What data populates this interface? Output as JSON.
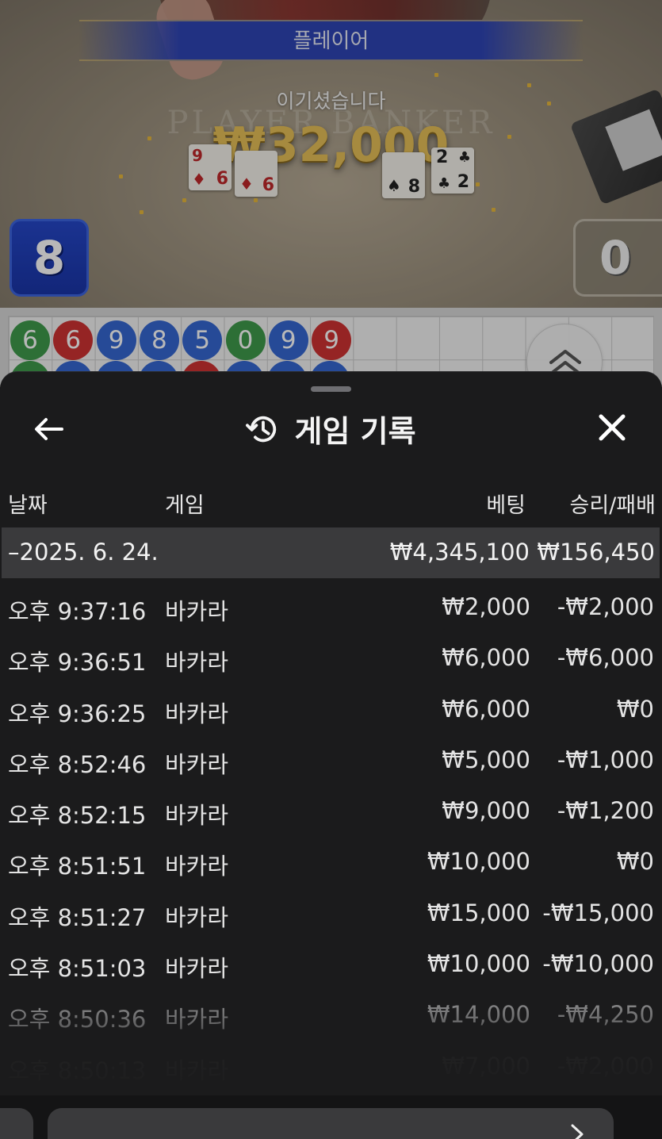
{
  "video": {
    "banner_label": "플레이어",
    "win_message": "이기셨습니다",
    "win_amount": "₩32,000",
    "table_text": "PLAYER    BANKER",
    "player_score": "8",
    "banker_score": "0",
    "player_cards": [
      {
        "rank": "9",
        "suit": "♦",
        "rank2": "6",
        "color": "red"
      },
      {
        "rank": "",
        "suit": "♦",
        "rank2": "6",
        "color": "red"
      }
    ],
    "banker_cards": [
      {
        "rank": "",
        "suit": "♠",
        "rank2": "8",
        "color": "black"
      },
      {
        "rank": "2",
        "suit": "♣",
        "rank2": "2",
        "color": "black"
      }
    ]
  },
  "roadmap": {
    "beads": [
      {
        "value": "6",
        "color": "green"
      },
      {
        "value": "6",
        "color": "red"
      },
      {
        "value": "9",
        "color": "blue"
      },
      {
        "value": "8",
        "color": "blue"
      },
      {
        "value": "5",
        "color": "blue"
      },
      {
        "value": "0",
        "color": "green"
      },
      {
        "value": "9",
        "color": "blue"
      },
      {
        "value": "9",
        "color": "red"
      }
    ]
  },
  "sheet": {
    "title": "게임 기록",
    "columns": {
      "date": "날짜",
      "game": "게임",
      "bet": "베팅",
      "result": "승리/패배"
    },
    "date_group": {
      "date": "–2025. 6. 24.",
      "total_bet": "₩4,345,100",
      "total_result": "₩156,450"
    },
    "rows": [
      {
        "time": "오후 9:37:16",
        "game": "바카라",
        "bet": "₩2,000",
        "result": "-₩2,000"
      },
      {
        "time": "오후 9:36:51",
        "game": "바카라",
        "bet": "₩6,000",
        "result": "-₩6,000"
      },
      {
        "time": "오후 9:36:25",
        "game": "바카라",
        "bet": "₩6,000",
        "result": "₩0"
      },
      {
        "time": "오후 8:52:46",
        "game": "바카라",
        "bet": "₩5,000",
        "result": "-₩1,000"
      },
      {
        "time": "오후 8:52:15",
        "game": "바카라",
        "bet": "₩9,000",
        "result": "-₩1,200"
      },
      {
        "time": "오후 8:51:51",
        "game": "바카라",
        "bet": "₩10,000",
        "result": "₩0"
      },
      {
        "time": "오후 8:51:27",
        "game": "바카라",
        "bet": "₩15,000",
        "result": "-₩15,000"
      },
      {
        "time": "오후 8:51:03",
        "game": "바카라",
        "bet": "₩10,000",
        "result": "-₩10,000"
      },
      {
        "time": "오후 8:50:36",
        "game": "바카라",
        "bet": "₩14,000",
        "result": "-₩4,250"
      },
      {
        "time": "오후 8:50:13",
        "game": "바카라",
        "bet": "₩7,000",
        "result": "-₩2,000"
      }
    ]
  },
  "icons": {
    "back": "arrow-left-icon",
    "close": "close-icon",
    "history": "history-icon",
    "expand": "chevron-double-up-icon",
    "forward": "chevron-right-icon"
  }
}
